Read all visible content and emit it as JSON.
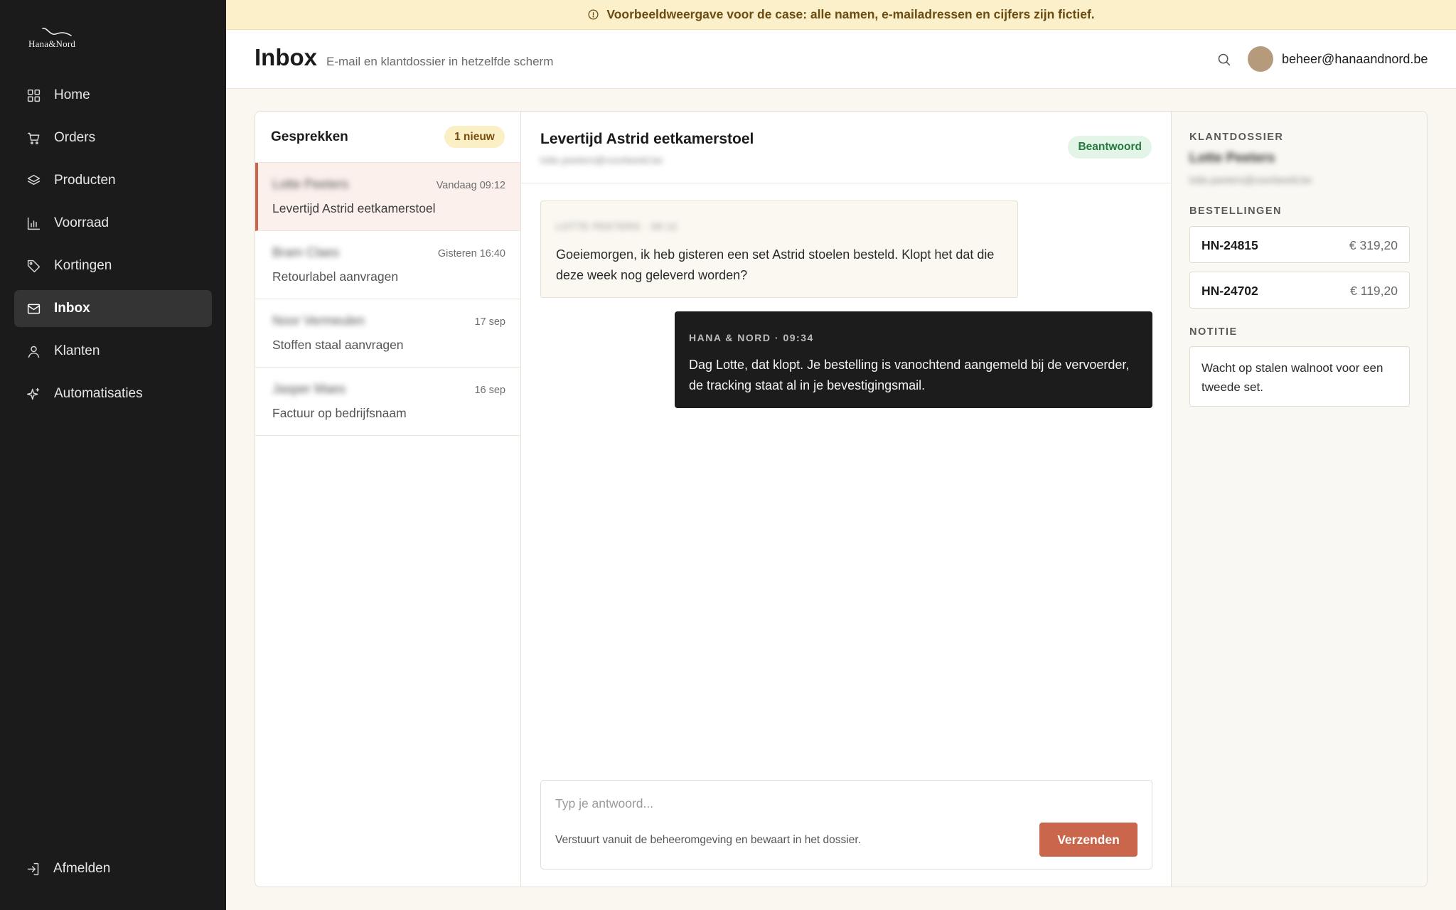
{
  "banner": {
    "text": "Voorbeeldweergave voor de case: alle namen, e-mailadressen en cijfers zijn fictief."
  },
  "brand": {
    "logo_text": "Hana&Nord"
  },
  "sidebar": {
    "items": [
      {
        "label": "Home",
        "icon": "grid-icon"
      },
      {
        "label": "Orders",
        "icon": "cart-icon"
      },
      {
        "label": "Producten",
        "icon": "layers-icon"
      },
      {
        "label": "Voorraad",
        "icon": "bar-chart-icon"
      },
      {
        "label": "Kortingen",
        "icon": "tag-icon"
      },
      {
        "label": "Inbox",
        "icon": "mail-icon",
        "active": true
      },
      {
        "label": "Klanten",
        "icon": "user-icon"
      },
      {
        "label": "Automatisaties",
        "icon": "sparkle-icon"
      }
    ],
    "logout_label": "Afmelden"
  },
  "header": {
    "title": "Inbox",
    "subtitle": "E-mail en klantdossier in hetzelfde scherm",
    "user_email": "beheer@hanaandnord.be"
  },
  "conversations": {
    "title": "Gesprekken",
    "badge": "1 nieuw",
    "items": [
      {
        "name": "Lotte Peeters",
        "time": "Vandaag 09:12",
        "subject": "Levertijd Astrid eetkamerstoel",
        "active": true
      },
      {
        "name": "Bram Claes",
        "time": "Gisteren 16:40",
        "subject": "Retourlabel aanvragen"
      },
      {
        "name": "Noor Vermeulen",
        "time": "17 sep",
        "subject": "Stoffen staal aanvragen"
      },
      {
        "name": "Jasper Maes",
        "time": "16 sep",
        "subject": "Factuur op bedrijfsnaam"
      }
    ]
  },
  "thread": {
    "title": "Levertijd Astrid eetkamerstoel",
    "email": "lotte.peeters@voorbeeld.be",
    "status": "Beantwoord",
    "messages": [
      {
        "meta": "LOTTE PEETERS · 09:12",
        "body": "Goeiemorgen, ik heb gisteren een set Astrid stoelen besteld. Klopt het dat die deze week nog geleverd worden?"
      },
      {
        "meta": "HANA & NORD · 09:34",
        "body": "Dag Lotte, dat klopt. Je bestelling is vanochtend aangemeld bij de vervoerder, de tracking staat al in je bevestigingsmail."
      }
    ],
    "composer": {
      "placeholder": "Typ je antwoord...",
      "hint": "Verstuurt vanuit de beheeromgeving en bewaart in het dossier.",
      "send_label": "Verzenden"
    }
  },
  "dossier": {
    "label": "KLANTDOSSIER",
    "customer_name": "Lotte Peeters",
    "customer_email": "lotte.peeters@voorbeeld.be",
    "orders_label": "BESTELLINGEN",
    "orders": [
      {
        "id": "HN-24815",
        "amount": "€ 319,20"
      },
      {
        "id": "HN-24702",
        "amount": "€ 119,20"
      }
    ],
    "note_label": "NOTITIE",
    "note": "Wacht op stalen walnoot voor een tweede set."
  },
  "colors": {
    "sidebar_bg": "#1b1b1b",
    "accent": "#c9664b",
    "banner_bg": "#fbf0c9",
    "status_green": "#237a3d"
  }
}
